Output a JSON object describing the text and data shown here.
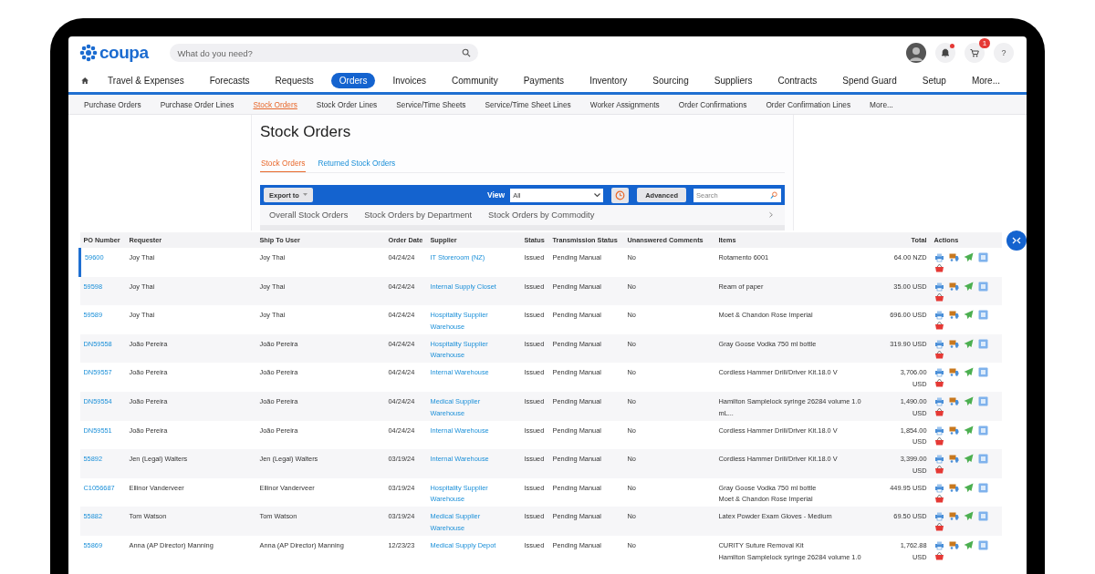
{
  "header": {
    "logo": "coupa",
    "search": {
      "placeholder": "What do you need?"
    },
    "notifications": {
      "unread": true
    },
    "cart": {
      "badge": "1"
    },
    "help": "?"
  },
  "nav": [
    {
      "label": "Travel & Expenses",
      "selected": false
    },
    {
      "label": "Forecasts",
      "selected": false
    },
    {
      "label": "Requests",
      "selected": false
    },
    {
      "label": "Orders",
      "selected": true
    },
    {
      "label": "Invoices",
      "selected": false
    },
    {
      "label": "Community",
      "selected": false
    },
    {
      "label": "Payments",
      "selected": false
    },
    {
      "label": "Inventory",
      "selected": false
    },
    {
      "label": "Sourcing",
      "selected": false
    },
    {
      "label": "Suppliers",
      "selected": false
    },
    {
      "label": "Contracts",
      "selected": false
    },
    {
      "label": "Spend Guard",
      "selected": false
    },
    {
      "label": "Setup",
      "selected": false
    },
    {
      "label": "More...",
      "selected": false
    }
  ],
  "subnav": [
    {
      "label": "Purchase Orders",
      "selected": false
    },
    {
      "label": "Purchase Order Lines",
      "selected": false
    },
    {
      "label": "Stock Orders",
      "selected": true
    },
    {
      "label": "Stock Order Lines",
      "selected": false
    },
    {
      "label": "Service/Time Sheets",
      "selected": false
    },
    {
      "label": "Service/Time Sheet Lines",
      "selected": false
    },
    {
      "label": "Worker Assignments",
      "selected": false
    },
    {
      "label": "Order Confirmations",
      "selected": false
    },
    {
      "label": "Order Confirmation Lines",
      "selected": false
    },
    {
      "label": "More...",
      "selected": false
    }
  ],
  "page_title": "Stock Orders",
  "tabs": [
    {
      "label": "Stock Orders",
      "selected": true
    },
    {
      "label": "Returned Stock Orders",
      "selected": false
    }
  ],
  "toolbar": {
    "export": "Export to",
    "view_label": "View",
    "view_value": "All",
    "advanced": "Advanced",
    "search_placeholder": "Search"
  },
  "chart_tabs": [
    "Overall Stock Orders",
    "Stock Orders by Department",
    "Stock Orders by Commodity"
  ],
  "table": {
    "columns": [
      "PO Number",
      "Requester",
      "Ship To User",
      "Order Date",
      "Supplier",
      "Status",
      "Transmission Status",
      "Unanswered Comments",
      "Items",
      "Total",
      "Actions"
    ],
    "rows": [
      {
        "selected": true,
        "po": "59600",
        "requester": "Joy Thai",
        "ship_to": "Joy Thai",
        "date": "04/24/24",
        "supplier": "IT Storeroom (NZ)",
        "status": "Issued",
        "transmission": "Pending Manual",
        "comments": "No",
        "items": [
          "Rotamento 6001"
        ],
        "total": "64.00 NZD"
      },
      {
        "selected": false,
        "po": "59598",
        "requester": "Joy Thai",
        "ship_to": "Joy Thai",
        "date": "04/24/24",
        "supplier": "Internal Supply Closet",
        "status": "Issued",
        "transmission": "Pending Manual",
        "comments": "No",
        "items": [
          "Ream of paper"
        ],
        "total": "35.00 USD"
      },
      {
        "selected": false,
        "po": "59589",
        "requester": "Joy Thai",
        "ship_to": "Joy Thai",
        "date": "04/24/24",
        "supplier": "Hospitality Supplier Warehouse",
        "status": "Issued",
        "transmission": "Pending Manual",
        "comments": "No",
        "items": [
          "Moet & Chandon Rose Imperial"
        ],
        "total": "696.00 USD"
      },
      {
        "selected": false,
        "po": "DN59558",
        "requester": "João Pereira",
        "ship_to": "João Pereira",
        "date": "04/24/24",
        "supplier": "Hospitality Supplier Warehouse",
        "status": "Issued",
        "transmission": "Pending Manual",
        "comments": "No",
        "items": [
          "Gray Goose Vodka 750 ml bottle"
        ],
        "total": "319.90 USD"
      },
      {
        "selected": false,
        "po": "DN59557",
        "requester": "João Pereira",
        "ship_to": "João Pereira",
        "date": "04/24/24",
        "supplier": "Internal Warehouse",
        "status": "Issued",
        "transmission": "Pending Manual",
        "comments": "No",
        "items": [
          "Cordless Hammer Drill/Driver Kit.18.0 V"
        ],
        "total": "3,706.00 USD"
      },
      {
        "selected": false,
        "po": "DN59554",
        "requester": "João Pereira",
        "ship_to": "João Pereira",
        "date": "04/24/24",
        "supplier": "Medical Supplier Warehouse",
        "status": "Issued",
        "transmission": "Pending Manual",
        "comments": "No",
        "items": [
          "Hamilton Samplelock syringe 26284 volume 1.0 mL..."
        ],
        "total": "1,490.00 USD"
      },
      {
        "selected": false,
        "po": "DN59551",
        "requester": "João Pereira",
        "ship_to": "João Pereira",
        "date": "04/24/24",
        "supplier": "Internal Warehouse",
        "status": "Issued",
        "transmission": "Pending Manual",
        "comments": "No",
        "items": [
          "Cordless Hammer Drill/Driver Kit.18.0 V"
        ],
        "total": "1,854.00 USD"
      },
      {
        "selected": false,
        "po": "55892",
        "requester": "Jen (Legal) Walters",
        "ship_to": "Jen (Legal) Walters",
        "date": "03/19/24",
        "supplier": "Internal Warehouse",
        "status": "Issued",
        "transmission": "Pending Manual",
        "comments": "No",
        "items": [
          "Cordless Hammer Drill/Driver Kit.18.0 V"
        ],
        "total": "3,399.00 USD"
      },
      {
        "selected": false,
        "po": "C1056687",
        "requester": "Ellinor Vanderveer",
        "ship_to": "Ellinor Vanderveer",
        "date": "03/19/24",
        "supplier": "Hospitality Supplier Warehouse",
        "status": "Issued",
        "transmission": "Pending Manual",
        "comments": "No",
        "items": [
          "Gray Goose Vodka 750 ml bottle",
          "Moet & Chandon Rose Imperial"
        ],
        "total": "449.95 USD"
      },
      {
        "selected": false,
        "po": "55882",
        "requester": "Tom Watson",
        "ship_to": "Tom Watson",
        "date": "03/19/24",
        "supplier": "Medical Supplier Warehouse",
        "status": "Issued",
        "transmission": "Pending Manual",
        "comments": "No",
        "items": [
          "Latex Powder Exam Gloves - Medium"
        ],
        "total": "69.50 USD"
      },
      {
        "selected": false,
        "po": "55869",
        "requester": "Anna (AP Director) Manning",
        "ship_to": "Anna (AP Director) Manning",
        "date": "12/23/23",
        "supplier": "Medical Supply Depot",
        "status": "Issued",
        "transmission": "Pending Manual",
        "comments": "No",
        "items": [
          "CURITY Suture Removal Kit",
          "Hamilton Samplelock syringe 26284 volume 1.0"
        ],
        "total": "1,762.88 USD"
      }
    ]
  }
}
